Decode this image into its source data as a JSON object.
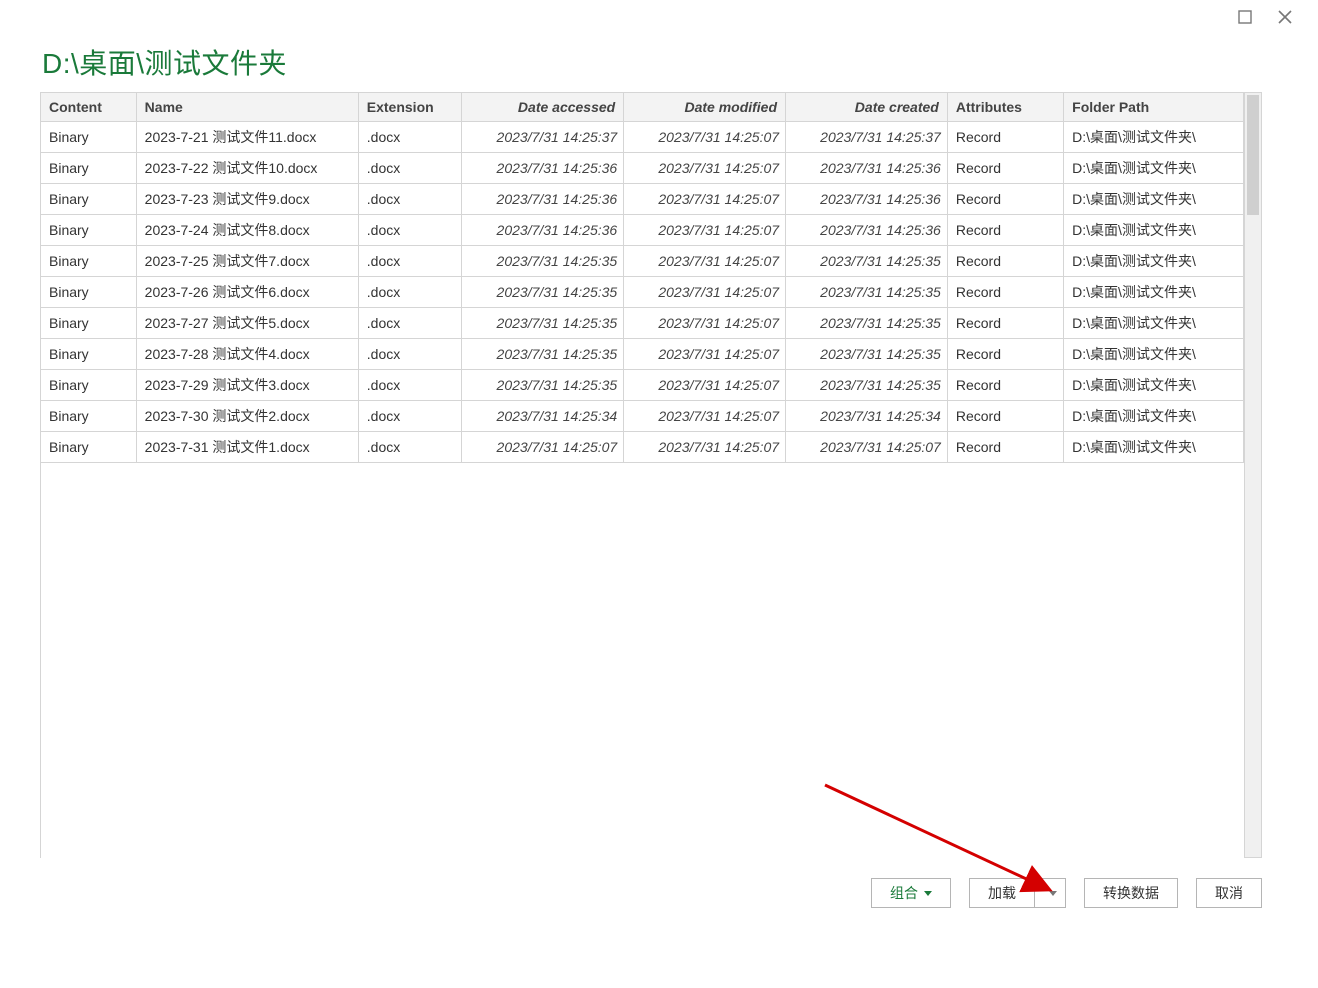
{
  "header": {
    "path_title": "D:\\桌面\\测试文件夹"
  },
  "table": {
    "columns": [
      "Content",
      "Name",
      "Extension",
      "Date accessed",
      "Date modified",
      "Date created",
      "Attributes",
      "Folder Path"
    ],
    "rows": [
      {
        "content": "Binary",
        "name": "2023-7-21 测试文件11.docx",
        "ext": ".docx",
        "accessed": "2023/7/31 14:25:37",
        "modified": "2023/7/31 14:25:07",
        "created": "2023/7/31 14:25:37",
        "attr": "Record",
        "path": "D:\\桌面\\测试文件夹\\"
      },
      {
        "content": "Binary",
        "name": "2023-7-22 测试文件10.docx",
        "ext": ".docx",
        "accessed": "2023/7/31 14:25:36",
        "modified": "2023/7/31 14:25:07",
        "created": "2023/7/31 14:25:36",
        "attr": "Record",
        "path": "D:\\桌面\\测试文件夹\\"
      },
      {
        "content": "Binary",
        "name": "2023-7-23 测试文件9.docx",
        "ext": ".docx",
        "accessed": "2023/7/31 14:25:36",
        "modified": "2023/7/31 14:25:07",
        "created": "2023/7/31 14:25:36",
        "attr": "Record",
        "path": "D:\\桌面\\测试文件夹\\"
      },
      {
        "content": "Binary",
        "name": "2023-7-24 测试文件8.docx",
        "ext": ".docx",
        "accessed": "2023/7/31 14:25:36",
        "modified": "2023/7/31 14:25:07",
        "created": "2023/7/31 14:25:36",
        "attr": "Record",
        "path": "D:\\桌面\\测试文件夹\\"
      },
      {
        "content": "Binary",
        "name": "2023-7-25 测试文件7.docx",
        "ext": ".docx",
        "accessed": "2023/7/31 14:25:35",
        "modified": "2023/7/31 14:25:07",
        "created": "2023/7/31 14:25:35",
        "attr": "Record",
        "path": "D:\\桌面\\测试文件夹\\"
      },
      {
        "content": "Binary",
        "name": "2023-7-26 测试文件6.docx",
        "ext": ".docx",
        "accessed": "2023/7/31 14:25:35",
        "modified": "2023/7/31 14:25:07",
        "created": "2023/7/31 14:25:35",
        "attr": "Record",
        "path": "D:\\桌面\\测试文件夹\\"
      },
      {
        "content": "Binary",
        "name": "2023-7-27 测试文件5.docx",
        "ext": ".docx",
        "accessed": "2023/7/31 14:25:35",
        "modified": "2023/7/31 14:25:07",
        "created": "2023/7/31 14:25:35",
        "attr": "Record",
        "path": "D:\\桌面\\测试文件夹\\"
      },
      {
        "content": "Binary",
        "name": "2023-7-28 测试文件4.docx",
        "ext": ".docx",
        "accessed": "2023/7/31 14:25:35",
        "modified": "2023/7/31 14:25:07",
        "created": "2023/7/31 14:25:35",
        "attr": "Record",
        "path": "D:\\桌面\\测试文件夹\\"
      },
      {
        "content": "Binary",
        "name": "2023-7-29 测试文件3.docx",
        "ext": ".docx",
        "accessed": "2023/7/31 14:25:35",
        "modified": "2023/7/31 14:25:07",
        "created": "2023/7/31 14:25:35",
        "attr": "Record",
        "path": "D:\\桌面\\测试文件夹\\"
      },
      {
        "content": "Binary",
        "name": "2023-7-30 测试文件2.docx",
        "ext": ".docx",
        "accessed": "2023/7/31 14:25:34",
        "modified": "2023/7/31 14:25:07",
        "created": "2023/7/31 14:25:34",
        "attr": "Record",
        "path": "D:\\桌面\\测试文件夹\\"
      },
      {
        "content": "Binary",
        "name": "2023-7-31 测试文件1.docx",
        "ext": ".docx",
        "accessed": "2023/7/31 14:25:07",
        "modified": "2023/7/31 14:25:07",
        "created": "2023/7/31 14:25:07",
        "attr": "Record",
        "path": "D:\\桌面\\测试文件夹\\"
      }
    ]
  },
  "footer": {
    "combine_label": "组合",
    "load_label": "加载",
    "transform_label": "转换数据",
    "cancel_label": "取消"
  }
}
